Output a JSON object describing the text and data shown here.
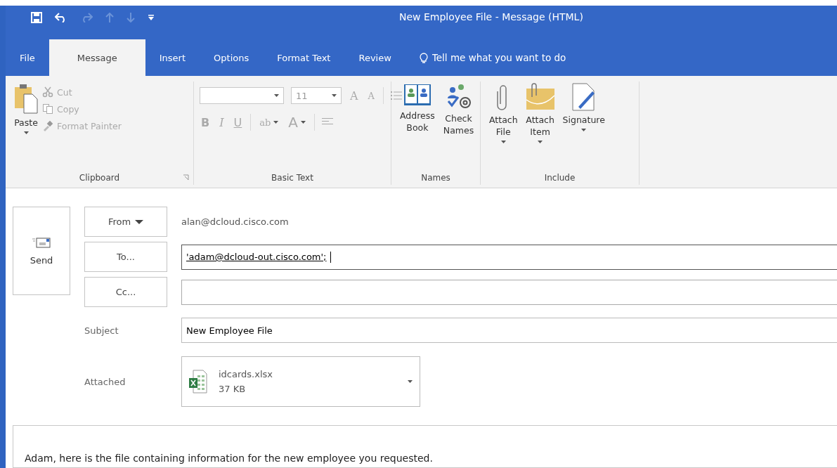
{
  "window": {
    "title": "New Employee File  -  Message (HTML)"
  },
  "tabs": [
    {
      "label": "File",
      "selected": false
    },
    {
      "label": "Message",
      "selected": true
    },
    {
      "label": "Insert",
      "selected": false
    },
    {
      "label": "Options",
      "selected": false
    },
    {
      "label": "Format Text",
      "selected": false
    },
    {
      "label": "Review",
      "selected": false
    }
  ],
  "tell_me": {
    "placeholder": "Tell me what you want to do"
  },
  "ribbon": {
    "clipboard": {
      "label": "Clipboard",
      "paste": "Paste",
      "items": [
        {
          "kind": "cut",
          "label": "Cut",
          "disabled": true
        },
        {
          "kind": "copy",
          "label": "Copy",
          "disabled": true
        },
        {
          "kind": "painter",
          "label": "Format Painter",
          "disabled": true
        }
      ]
    },
    "basic_text": {
      "label": "Basic Text",
      "font_size": "11",
      "grow": "A",
      "shrink": "A",
      "format_buttons": [
        "B",
        "I",
        "U"
      ],
      "highlight": "ab",
      "font_color": "A"
    },
    "names": {
      "label": "Names",
      "buttons": [
        {
          "kind": "address_book",
          "label": "Address Book"
        },
        {
          "kind": "check_names",
          "label": "Check Names"
        }
      ]
    },
    "include": {
      "label": "Include",
      "buttons": [
        {
          "kind": "attach_file",
          "label": "Attach File",
          "dropdown": true
        },
        {
          "kind": "attach_item",
          "label": "Attach Item",
          "dropdown": true
        },
        {
          "kind": "signature",
          "label": "Signature",
          "dropdown": true
        }
      ]
    }
  },
  "send": {
    "label": "Send"
  },
  "from": {
    "label": "From",
    "value": "alan@dcloud.cisco.com"
  },
  "to": {
    "label": "To...",
    "value": "'adam@dcloud-out.cisco.com';"
  },
  "cc": {
    "label": "Cc..."
  },
  "subject": {
    "label": "Subject",
    "value": "New Employee File"
  },
  "attached": {
    "label": "Attached",
    "file": "idcards.xlsx",
    "size": "37 KB"
  },
  "body": "Adam, here is the file containing information for the new employee you requested."
}
